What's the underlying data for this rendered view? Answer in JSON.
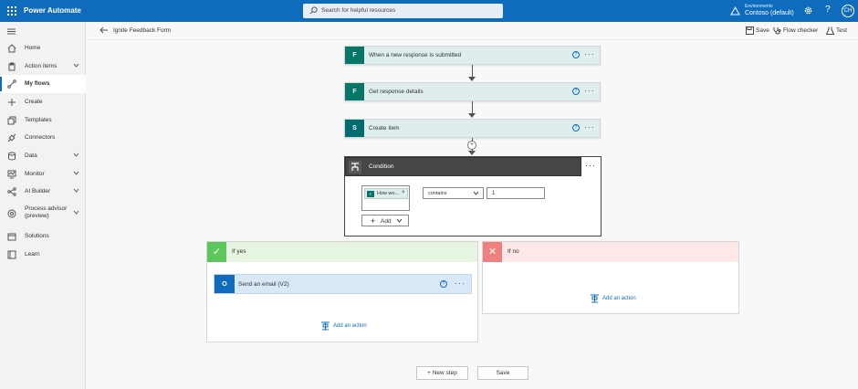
{
  "topbar": {
    "app_name": "Power Automate",
    "search_placeholder": "Search for helpful resources",
    "env_label": "Environments",
    "env_name": "Contoso (default)",
    "avatar_initials": "CH"
  },
  "sidebar": {
    "items": [
      {
        "label": "Home",
        "icon": "home-icon"
      },
      {
        "label": "Action items",
        "icon": "clipboard-icon",
        "expandable": true
      },
      {
        "label": "My flows",
        "icon": "flow-icon",
        "active": true
      },
      {
        "label": "Create",
        "icon": "plus-icon"
      },
      {
        "label": "Templates",
        "icon": "templates-icon"
      },
      {
        "label": "Connectors",
        "icon": "connector-icon"
      },
      {
        "label": "Data",
        "icon": "database-icon",
        "expandable": true
      },
      {
        "label": "Monitor",
        "icon": "monitor-icon",
        "expandable": true
      },
      {
        "label": "AI Builder",
        "icon": "ai-builder-icon",
        "expandable": true
      },
      {
        "label_line1": "Process advisor",
        "label_line2": "(preview)",
        "icon": "process-advisor-icon",
        "expandable": true
      },
      {
        "label": "Solutions",
        "icon": "solutions-icon"
      },
      {
        "label": "Learn",
        "icon": "book-icon"
      }
    ]
  },
  "cmdbar": {
    "flow_name": "Ignite Feedback Form",
    "save": "Save",
    "flow_checker": "Flow checker",
    "test": "Test"
  },
  "steps": [
    {
      "label": "When a new response is submitted",
      "connector": "Microsoft Forms",
      "color": "#077568"
    },
    {
      "label": "Get response details",
      "connector": "Microsoft Forms",
      "color": "#077568"
    },
    {
      "label": "Create item",
      "connector": "SharePoint",
      "color": "#036c70"
    }
  ],
  "condition": {
    "title": "Condition",
    "token_label": "How wo...",
    "operator": "contains",
    "value": "1",
    "add_label": "Add"
  },
  "branches": {
    "yes": {
      "title": "If yes",
      "color": "#5cc85c",
      "action_label": "Send an email (V2)",
      "add_action": "Add an action"
    },
    "no": {
      "title": "If no",
      "color": "#f08080",
      "add_action": "Add an action"
    }
  },
  "footer": {
    "new_step": "+ New step",
    "save": "Save"
  }
}
